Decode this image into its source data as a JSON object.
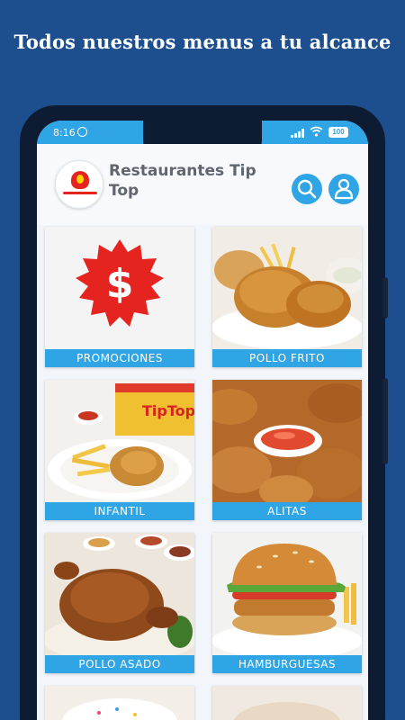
{
  "headline": "Todos nuestros menus a tu alcance",
  "status_bar": {
    "time": "8:16",
    "battery": "100"
  },
  "app": {
    "title": "Restaurantes Tip Top",
    "search_icon": "search-icon",
    "user_icon": "user-icon"
  },
  "menu": [
    {
      "label": "PROMOCIONES"
    },
    {
      "label": "POLLO FRITO"
    },
    {
      "label": "INFANTIL"
    },
    {
      "label": "ALITAS"
    },
    {
      "label": "POLLO ASADO"
    },
    {
      "label": "HAMBURGUESAS"
    }
  ],
  "colors": {
    "background": "#1d4f8f",
    "accent": "#2fa5e6",
    "promo_red": "#e52420"
  }
}
